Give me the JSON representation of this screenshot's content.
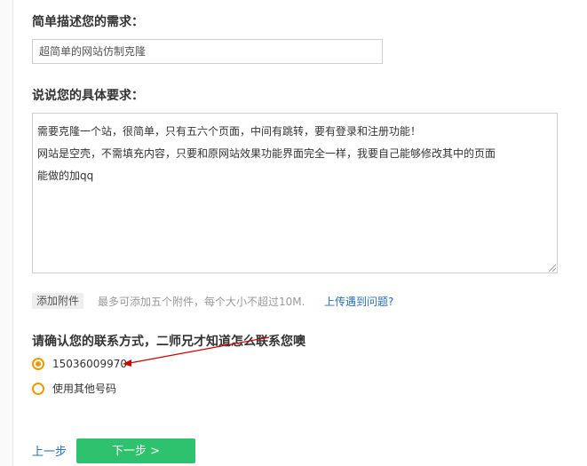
{
  "summary": {
    "label": "简单描述您的需求：",
    "value": "超简单的网站仿制克隆"
  },
  "details": {
    "label": "说说您的具体要求：",
    "lines": [
      "需要克隆一个站，很简单，只有五六个页面，中间有跳转，要有登录和注册功能！",
      "网站是空壳，不需填充内容，只要和原网站效果功能界面完全一样，我要自己能够修改其中的页面",
      "能做的加qq"
    ]
  },
  "attachments": {
    "button_label": "添加附件",
    "hint": "最多可添加五个附件，每个大小不超过10M.",
    "help_link": "上传遇到问题?"
  },
  "contact": {
    "label": "请确认您的联系方式，二师兄才知道怎么联系您噢",
    "options": [
      {
        "label": "15036009970",
        "checked": true
      },
      {
        "label": "使用其他号码",
        "checked": false
      }
    ]
  },
  "navigation": {
    "prev_label": "上一步",
    "next_label": "下一步 >"
  },
  "colors": {
    "accent_green": "#2ec26e",
    "radio_orange": "#f39800",
    "link_blue": "#2a6fb7",
    "annotation_red": "#cc0000"
  }
}
